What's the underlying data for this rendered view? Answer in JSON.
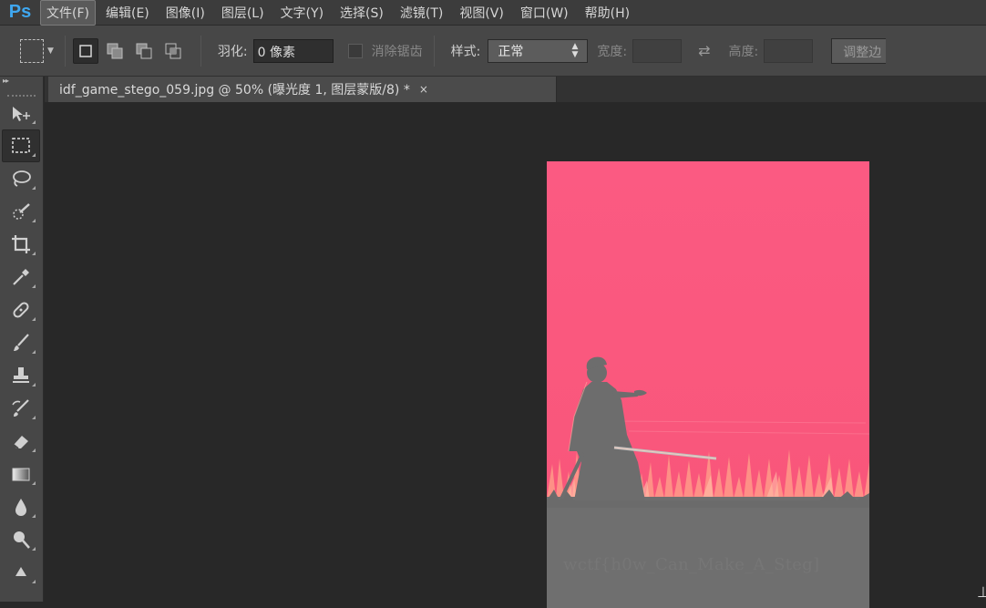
{
  "app": {
    "logo": "Ps"
  },
  "menu": [
    {
      "label": "文件(F)",
      "active": true
    },
    {
      "label": "编辑(E)"
    },
    {
      "label": "图像(I)"
    },
    {
      "label": "图层(L)"
    },
    {
      "label": "文字(Y)"
    },
    {
      "label": "选择(S)"
    },
    {
      "label": "滤镜(T)"
    },
    {
      "label": "视图(V)"
    },
    {
      "label": "窗口(W)"
    },
    {
      "label": "帮助(H)"
    }
  ],
  "options": {
    "feather_label": "羽化:",
    "feather_value": "0 像素",
    "antialias_label": "消除锯齿",
    "style_label": "样式:",
    "style_value": "正常",
    "width_label": "宽度:",
    "height_label": "高度:",
    "refine_label": "调整边"
  },
  "document": {
    "tab_title": "idf_game_stego_059.jpg @ 50% (曝光度 1, 图层蒙版/8) *",
    "close_glyph": "×",
    "flag_text": "wctf{h0w_Can_Make_A_Steg]"
  },
  "tools": [
    "move-tool",
    "rect-marquee-tool",
    "lasso-tool",
    "quick-select-tool",
    "crop-tool",
    "eyedropper-tool",
    "healing-brush-tool",
    "brush-tool",
    "clone-stamp-tool",
    "history-brush-tool",
    "eraser-tool",
    "gradient-tool",
    "blur-tool",
    "dodge-tool",
    "pen-tool"
  ],
  "colors": {
    "accent_logo": "#3fa7f0",
    "image_sky": "#f95a80",
    "image_ground": "#6f6f6f"
  }
}
